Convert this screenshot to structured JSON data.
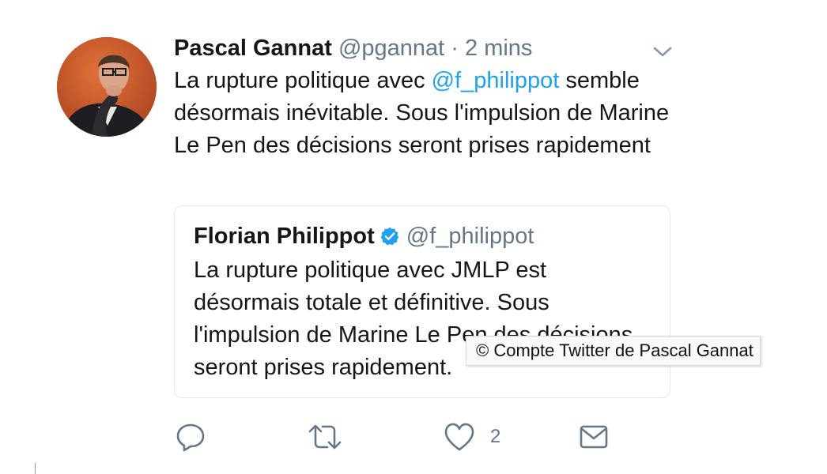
{
  "tweet": {
    "author_name": "Pascal Gannat",
    "author_handle": "@pgannat",
    "separator": "·",
    "time": "2 mins",
    "text_before_mention": "La rupture politique avec ",
    "mention": "@f_philippot",
    "text_after_mention": " semble désormais inévitable. Sous l'impulsion de Marine Le Pen des décisions seront prises rapidement"
  },
  "quoted_tweet": {
    "author_name": "Florian Philippot",
    "author_handle": "@f_philippot",
    "verified": true,
    "text": "La rupture politique avec JMLP est désormais totale et définitive. Sous l'impulsion de Marine Le Pen des décisions seront prises rapidement."
  },
  "image_caption": "© Compte Twitter de Pascal Gannat",
  "actions": {
    "reply_icon": "reply-icon",
    "retweet_icon": "retweet-icon",
    "like_icon": "heart-icon",
    "like_count": "2",
    "dm_icon": "envelope-icon"
  },
  "colors": {
    "link": "#1da1f2",
    "secondary_text": "#657786",
    "border": "#e1e8ed",
    "verified_badge": "#1da1f2"
  }
}
